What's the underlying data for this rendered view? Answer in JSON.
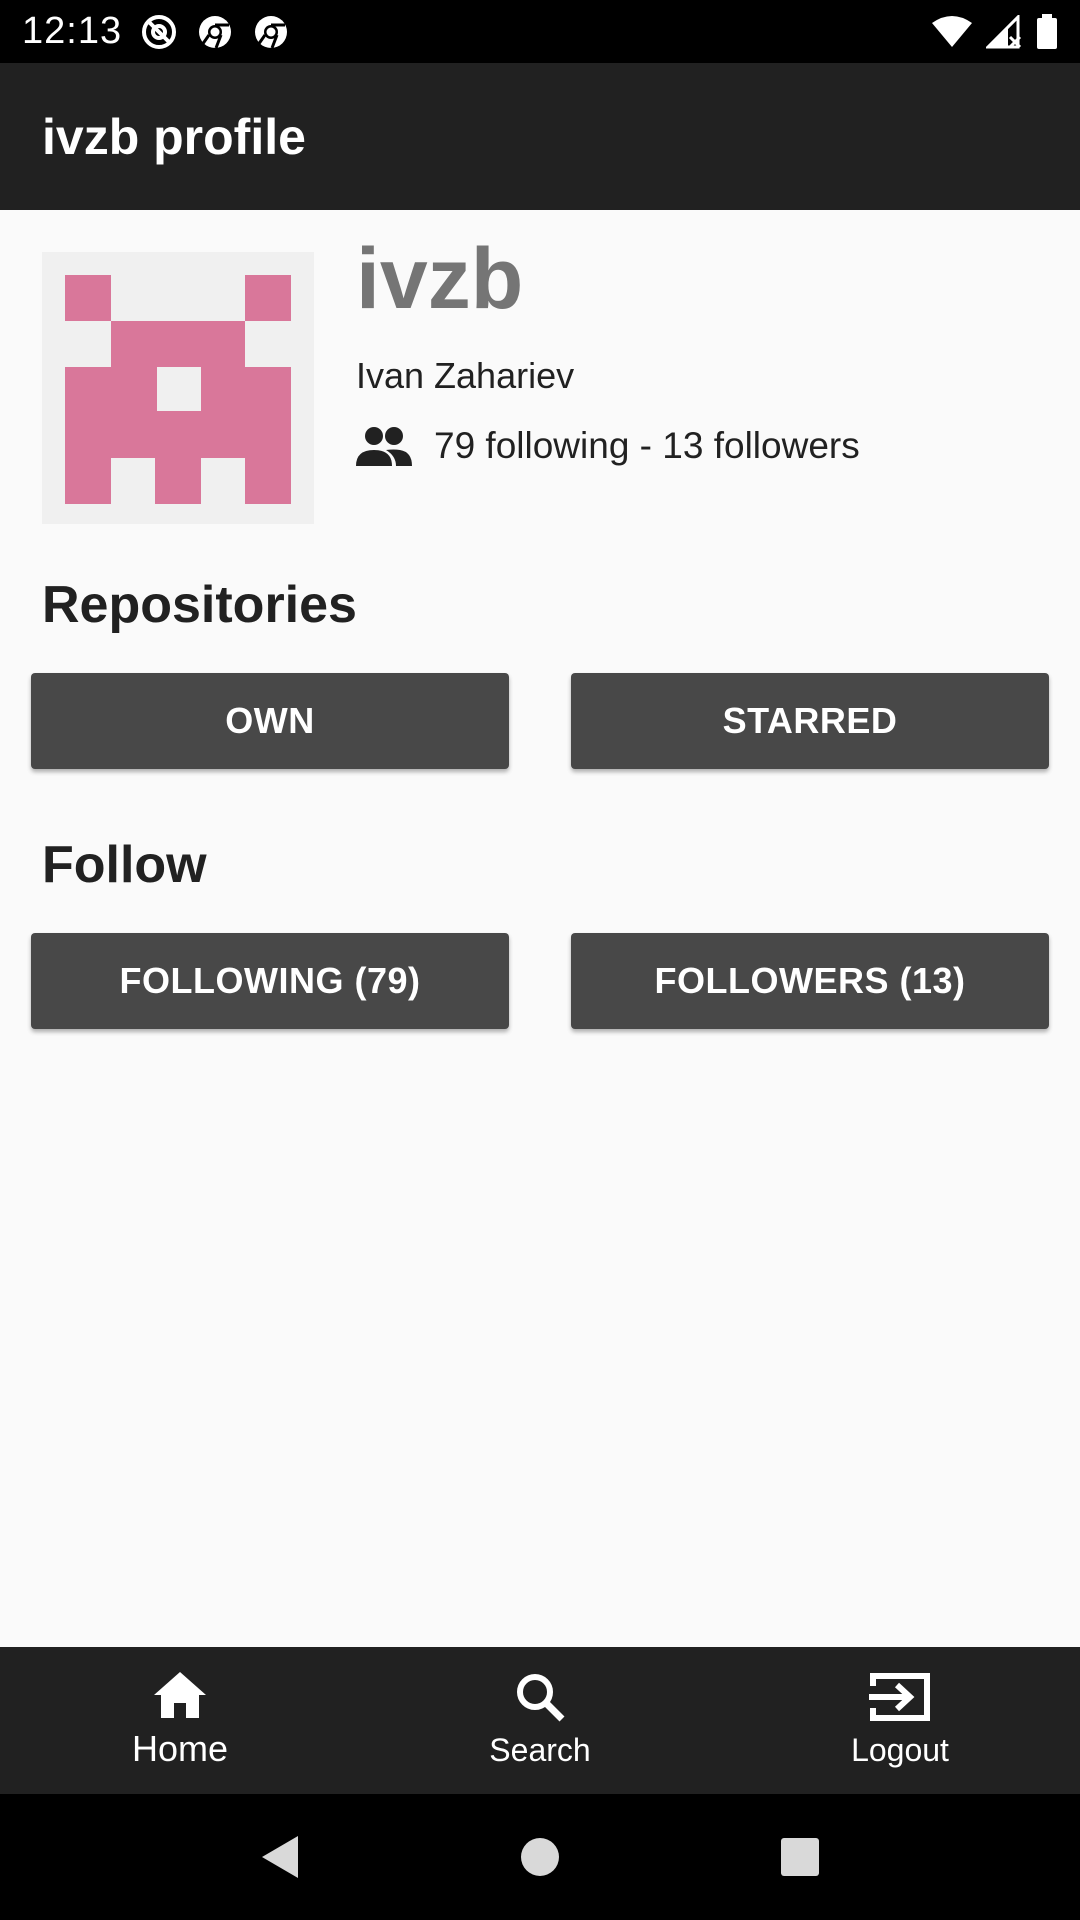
{
  "status_bar": {
    "time": "12:13",
    "left_icons": [
      "at-sign-icon",
      "chrome-icon",
      "chrome-icon"
    ],
    "right_icons": [
      "wifi-icon",
      "signal-icon",
      "battery-icon"
    ]
  },
  "app_bar": {
    "title": "ivzb profile"
  },
  "profile": {
    "username": "ivzb",
    "full_name": "Ivan Zahariev",
    "follow_summary": "79 following - 13 followers",
    "avatar_color": "#d9779a"
  },
  "sections": {
    "repositories": {
      "title": "Repositories",
      "own_label": "OWN",
      "starred_label": "STARRED"
    },
    "follow": {
      "title": "Follow",
      "following_label": "FOLLOWING (79)",
      "followers_label": "FOLLOWERS (13)"
    }
  },
  "bottom_nav": {
    "items": [
      {
        "label": "Home",
        "icon": "home-icon",
        "active": true
      },
      {
        "label": "Search",
        "icon": "search-icon",
        "active": false
      },
      {
        "label": "Logout",
        "icon": "logout-icon",
        "active": false
      }
    ]
  },
  "system_nav": {
    "buttons": [
      "back-icon",
      "home-circle-icon",
      "recents-icon"
    ]
  },
  "colors": {
    "app_bar": "#212121",
    "button": "#484848",
    "background": "#fafafa"
  }
}
